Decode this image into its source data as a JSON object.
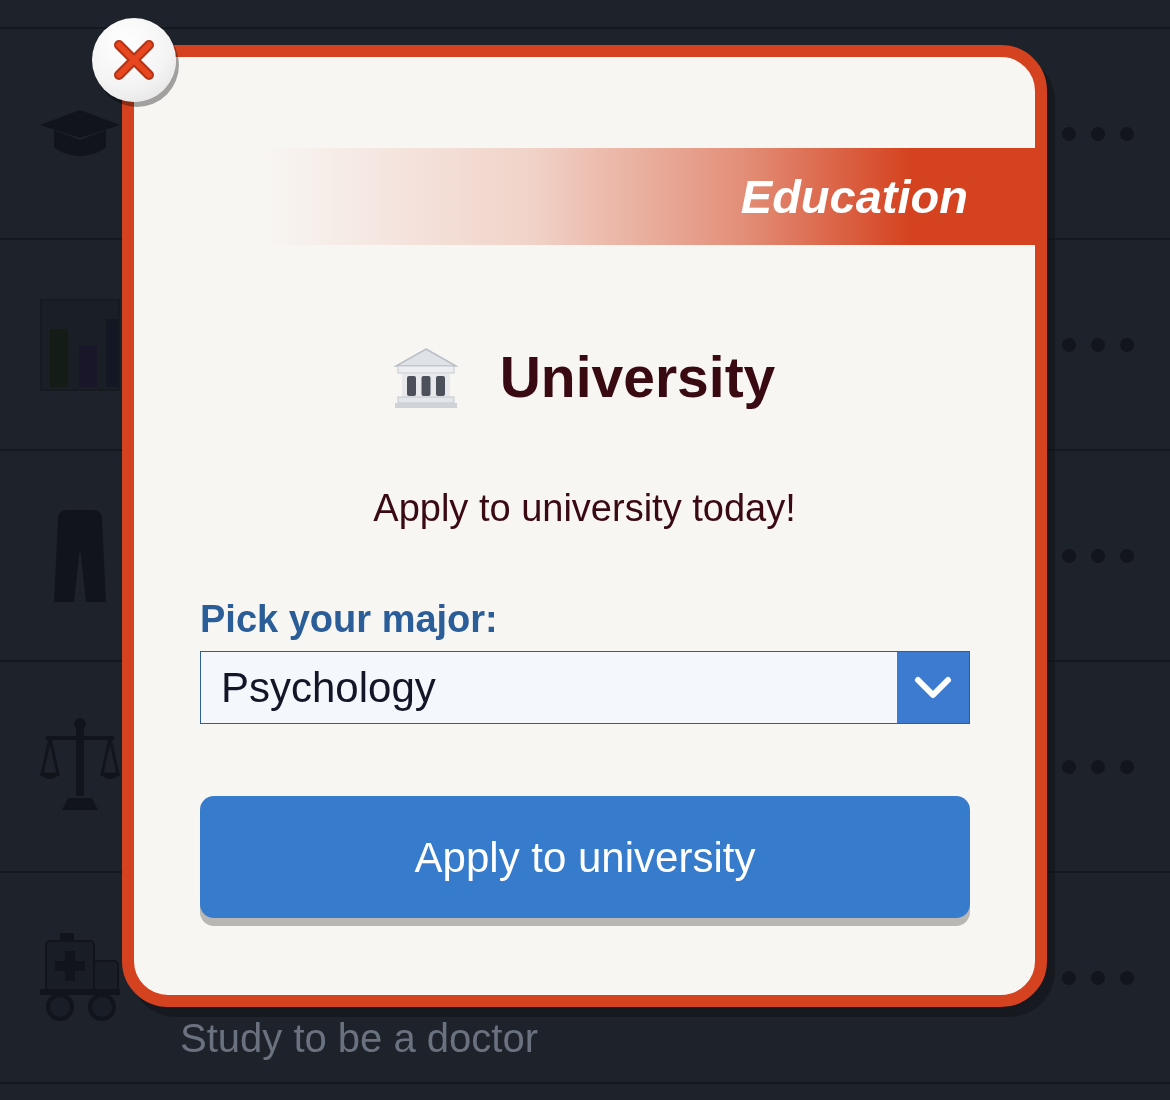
{
  "background_list": {
    "rows": [
      {},
      {},
      {},
      {},
      {
        "title": "Study to be a doctor"
      }
    ]
  },
  "dialog": {
    "category": "Education",
    "title": "University",
    "description": "Apply to university today!",
    "major_field": {
      "label": "Pick your major:",
      "value": "Psychology"
    },
    "buttons": [
      {
        "label": "Apply to university",
        "kind": "primary"
      }
    ]
  }
}
